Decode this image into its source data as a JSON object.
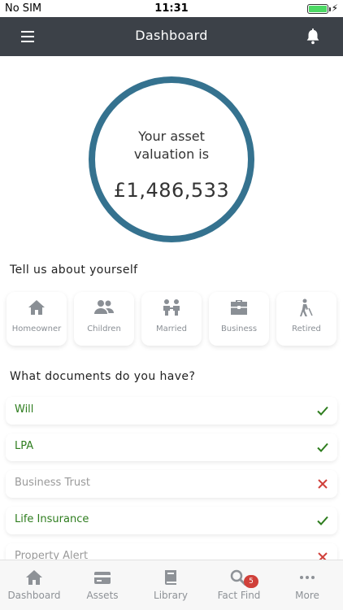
{
  "status_bar": {
    "carrier": "No SIM",
    "time": "11:31",
    "charging_icon": "bolt-icon"
  },
  "nav": {
    "title": "Dashboard",
    "menu_icon": "hamburger-icon",
    "notify_icon": "bell-icon"
  },
  "valuation": {
    "caption_line1": "Your asset",
    "caption_line2": "valuation is",
    "amount": "£1,486,533",
    "ring_color": "#35728f"
  },
  "profile": {
    "title": "Tell us about yourself",
    "items": [
      {
        "label": "Homeowner",
        "icon": "house-icon"
      },
      {
        "label": "Children",
        "icon": "people-icon"
      },
      {
        "label": "Married",
        "icon": "couple-icon"
      },
      {
        "label": "Business",
        "icon": "briefcase-icon"
      },
      {
        "label": "Retired",
        "icon": "walking-cane-icon"
      }
    ]
  },
  "documents": {
    "title": "What documents do you have?",
    "items": [
      {
        "label": "Will",
        "status": "yes"
      },
      {
        "label": "LPA",
        "status": "yes"
      },
      {
        "label": "Business Trust",
        "status": "no"
      },
      {
        "label": "Life Insurance",
        "status": "yes"
      },
      {
        "label": "Property Alert",
        "status": "no"
      }
    ],
    "yes_color": "#2e7d1e",
    "no_color": "#d0403a"
  },
  "tab_bar": {
    "tabs": [
      {
        "label": "Dashboard",
        "icon": "home-icon"
      },
      {
        "label": "Assets",
        "icon": "card-icon"
      },
      {
        "label": "Library",
        "icon": "book-icon"
      },
      {
        "label": "Fact Find",
        "icon": "search-icon",
        "badge": "5"
      },
      {
        "label": "More",
        "icon": "more-icon"
      }
    ]
  }
}
